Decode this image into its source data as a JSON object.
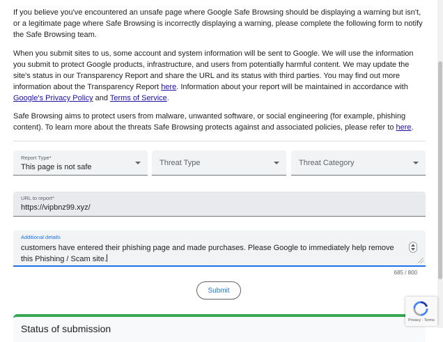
{
  "intro": {
    "p1": "If you believe you've encountered an unsafe page where Google Safe Browsing should be displaying a warning but isn't, or a legitimate page where Safe Browsing is incorrectly displaying a warning, please complete the following form to notify the Safe Browsing team.",
    "p2_part1": "When you submit sites to us, some account and system information will be sent to Google. We will use the information you submit to protect Google products, infrastructure, and users from potentially harmful content. We may update the site's status in our Transparency Report and share the URL and its status with third parties. You may find out more information about the Transparency Report ",
    "p2_link_here": "here",
    "p2_part2": ". Information about your report will be maintained in accordance with ",
    "p2_link_privacy": "Google's Privacy Policy",
    "p2_part3": " and ",
    "p2_link_terms": "Terms of Service",
    "p2_part4": ".",
    "p3_part1": "Safe Browsing aims to protect users from malware, unwanted software, or social engineering (for example, phishing content). To learn more about the threats Safe Browsing protects against and associated policies, please refer to ",
    "p3_link_here": "here",
    "p3_part2": "."
  },
  "form": {
    "report_type": {
      "label": "Report Type*",
      "value": "This page is not safe"
    },
    "threat_type": {
      "placeholder": "Threat Type"
    },
    "threat_category": {
      "placeholder": "Threat Category"
    },
    "url": {
      "label": "URL to report*",
      "value": "https://vipbnz99.xyz/"
    },
    "details": {
      "label": "Additional details",
      "value": "customers have entered their phishing page and made purchases. Please Google to immediately help remove this Phishing / Scam site."
    },
    "counter": "685 / 800",
    "submit_label": "Submit"
  },
  "status": {
    "title": "Status of submission"
  },
  "recaptcha": {
    "legal": "Privacy - Terms"
  },
  "colors": {
    "link": "#1a0dab",
    "accent": "#1a73e8",
    "status_green": "#34a853"
  }
}
